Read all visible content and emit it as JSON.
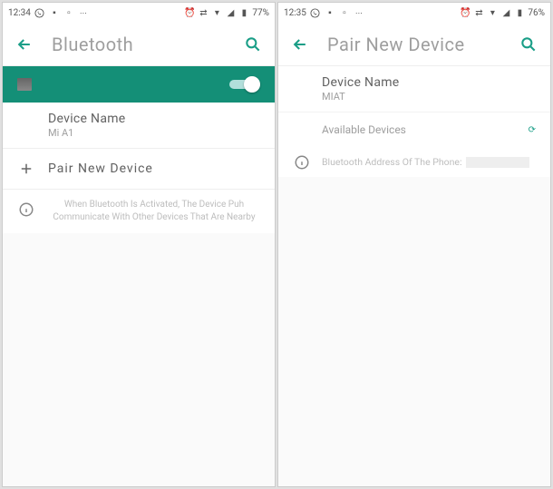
{
  "screen1": {
    "status": {
      "time": "12:34",
      "battery": "77%"
    },
    "header": {
      "title": "Bluetooth"
    },
    "device": {
      "label": "Device Name",
      "value": "Mi A1"
    },
    "pair": {
      "label": "Pair New Device"
    },
    "info": {
      "text": "When Bluetooth Is Activated, The Device Puh Communicate With Other Devices That Are Nearby"
    }
  },
  "screen2": {
    "status": {
      "time": "12:35",
      "battery": "76%"
    },
    "header": {
      "title": "Pair New Device"
    },
    "device": {
      "label": "Device Name",
      "value": "MIAT"
    },
    "available": {
      "label": "Available Devices"
    },
    "addr": {
      "label": "Bluetooth Address Of The Phone:"
    }
  }
}
